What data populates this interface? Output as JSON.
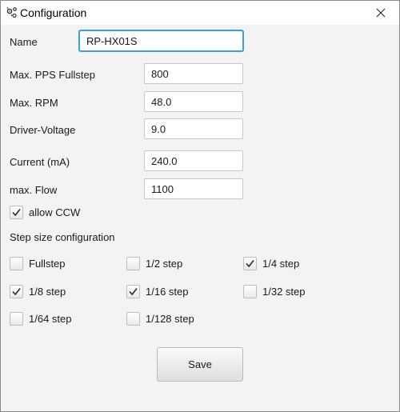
{
  "window": {
    "title": "Configuration",
    "app_icon": "gear-icon",
    "close_icon": "close-icon"
  },
  "form": {
    "name": {
      "label": "Name",
      "value": "RP-HX01S"
    },
    "max_pps_fullstep": {
      "label": "Max. PPS Fullstep",
      "value": "800"
    },
    "max_rpm": {
      "label": "Max. RPM",
      "value": "48.0"
    },
    "driver_voltage": {
      "label": "Driver-Voltage",
      "value": "9.0"
    },
    "current": {
      "label": "Current (mA)",
      "value": "240.0"
    },
    "max_flow": {
      "label": "max. Flow",
      "value": "1100"
    },
    "allow_ccw": {
      "label": "allow CCW",
      "checked": true
    }
  },
  "step_config": {
    "heading": "Step size configuration",
    "options": [
      {
        "label": "Fullstep",
        "checked": false
      },
      {
        "label": "1/2 step",
        "checked": false
      },
      {
        "label": "1/4 step",
        "checked": true
      },
      {
        "label": "1/8 step",
        "checked": true
      },
      {
        "label": "1/16 step",
        "checked": true
      },
      {
        "label": "1/32 step",
        "checked": false
      },
      {
        "label": "1/64 step",
        "checked": false
      },
      {
        "label": "1/128 step",
        "checked": false
      }
    ]
  },
  "actions": {
    "save_label": "Save"
  },
  "colors": {
    "focus_border": "#3c9fe0",
    "window_bg": "#f3f3f3",
    "titlebar_bg": "#ffffff"
  }
}
